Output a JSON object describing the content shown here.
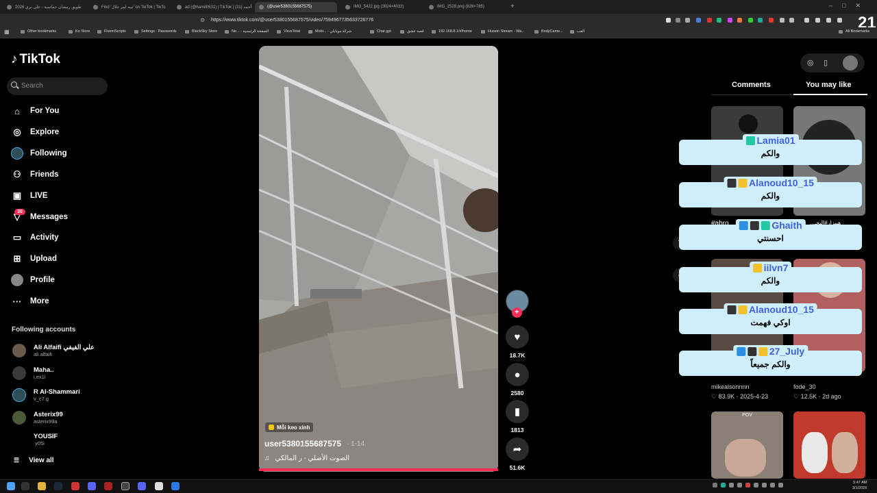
{
  "browser": {
    "tabs": [
      {
        "label": "طويق رمضان حماسية - على نري 2026",
        "active": false
      },
      {
        "label": "Find 'تيبه لمر جلال' on TikTok | TikTo",
        "active": false
      },
      {
        "label": "ad (@hamil0531) | TikTok | أحمد (31)",
        "active": false
      },
      {
        "label": "(@user5380155687575)",
        "active": true
      },
      {
        "label": "IMG_5422.jpg (3024×4032)",
        "active": false
      },
      {
        "label": "IMG_2528.png (828×785)",
        "active": false
      }
    ],
    "url": "https://www.tiktok.com/@user5380155687575/video/7594967735633726776",
    "bookmarks": [
      "Other bookmarks",
      "Ko Store",
      "FivemScripts",
      "Settings - Passwords",
      "BlackSky Store",
      "Ne... - الصفحة الرئيسية",
      "VirusTotal",
      "Mobi... - شركة موبايلي",
      "Chat gpt",
      "قصة عشق",
      "192.168.8.1/#/home",
      "Husein Stream - Wa...",
      "BodyCame...",
      "العب"
    ],
    "all_bookmarks": "All Bookmarks",
    "watermark": "21"
  },
  "sidebar": {
    "logo": "TikTok",
    "search_placeholder": "Search",
    "nav": [
      {
        "label": "For You",
        "icon": "home-icon"
      },
      {
        "label": "Explore",
        "icon": "compass-icon"
      },
      {
        "label": "Following",
        "icon": "following-avatar-icon"
      },
      {
        "label": "Friends",
        "icon": "friends-icon"
      },
      {
        "label": "LIVE",
        "icon": "live-icon"
      },
      {
        "label": "Messages",
        "icon": "messages-icon"
      },
      {
        "label": "Activity",
        "icon": "activity-icon"
      },
      {
        "label": "Upload",
        "icon": "upload-icon"
      },
      {
        "label": "Profile",
        "icon": "profile-avatar-icon"
      },
      {
        "label": "More",
        "icon": "more-dots-icon"
      }
    ],
    "messages_badge": "30",
    "following_title": "Following accounts",
    "accounts": [
      {
        "name": "Ali Alfaifi علي الفيفي",
        "handle": "ali.alfaifi"
      },
      {
        "name": "Maha..",
        "handle": "i.ex1l"
      },
      {
        "name": "R Al-Shammari",
        "handle": "v_c7.g"
      },
      {
        "name": "Asterix99",
        "handle": "asterix99a"
      },
      {
        "name": "YOUSIF",
        "handle": ".y05i"
      }
    ],
    "view_all": "View all"
  },
  "video": {
    "effect_label": "Mỗi keo xinh",
    "username": "user5380155687575",
    "date": "· 1-14",
    "sound": "الصوت الأصلي - ر المالكي",
    "progress": 1.0
  },
  "actions": {
    "likes": "18.7K",
    "comments": "2580",
    "saves": "1813",
    "shares": "51.6K"
  },
  "right_panel": {
    "tabs": [
      "Comments",
      "You may like"
    ],
    "active_tab": "You may like",
    "thumb_caption_left": "#abro",
    "thumb_caption_right": "...هيبزار#البحـ",
    "row2": [
      {
        "author": "mikealsonnnn",
        "likes": "83.9K",
        "date": "2025-4-23"
      },
      {
        "author": "fode_30",
        "likes": "12.5K",
        "date": "2d ago"
      }
    ],
    "pov_label": "POV"
  },
  "chat_overlay": [
    {
      "name": "Lamia01",
      "message": "والكم"
    },
    {
      "name": "Alanoud10_15",
      "message": "والكم"
    },
    {
      "name": "Ghaith",
      "message": "احسنتي"
    },
    {
      "name": "iilvn7",
      "message": "والكم"
    },
    {
      "name": "Alanoud10_15",
      "message": "اوكي فهمت"
    },
    {
      "name": "27_July",
      "message": "والكم جميعاً"
    }
  ],
  "taskbar": {
    "time": "5:47 AM",
    "date": "3/1/2026"
  }
}
